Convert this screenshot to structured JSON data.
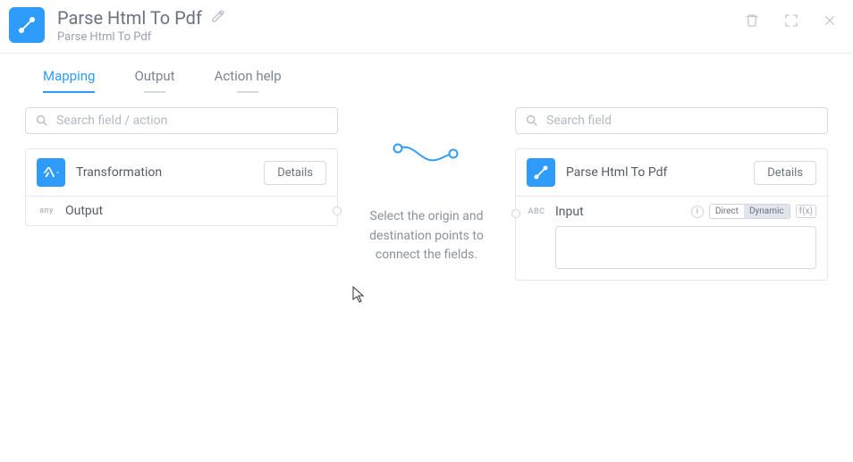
{
  "header": {
    "title": "Parse Html To Pdf",
    "subtitle": "Parse Html To Pdf"
  },
  "tabs": {
    "mapping": "Mapping",
    "output": "Output",
    "action_help": "Action help"
  },
  "left": {
    "search_placeholder": "Search field / action",
    "card_title": "Transformation",
    "details": "Details",
    "field_type": "any",
    "field_name": "Output"
  },
  "right": {
    "search_placeholder": "Search field",
    "card_title": "Parse Html To Pdf",
    "details": "Details",
    "field_type": "ABC",
    "field_name": "Input",
    "mode_direct": "Direct",
    "mode_dynamic": "Dynamic",
    "fx": "f(x)"
  },
  "hint": "Select the origin and destination points to connect the fields."
}
